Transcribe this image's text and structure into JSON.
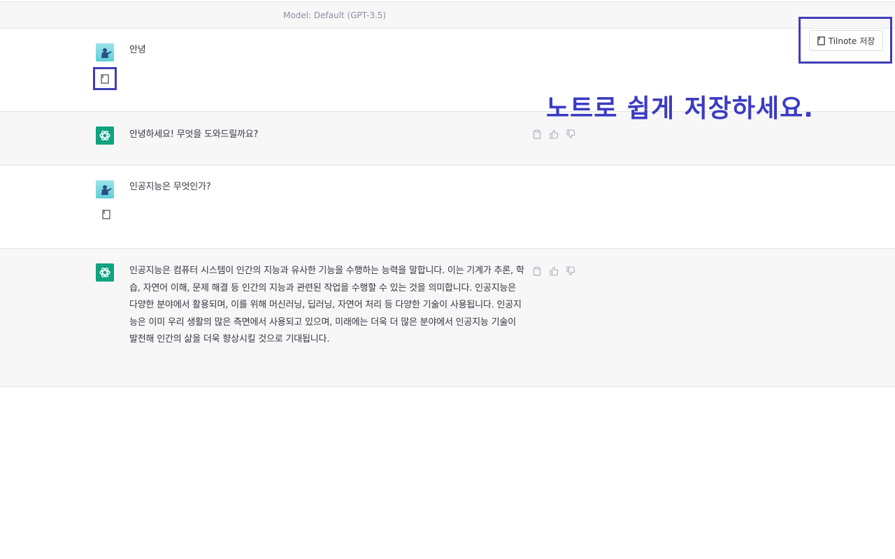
{
  "header": {
    "model_label": "Model: Default (GPT-3.5)"
  },
  "toolbar": {
    "save_button_label": "Tilnote 저장"
  },
  "promo": {
    "text": "노트로 쉽게 저장하세요."
  },
  "messages": [
    {
      "role": "user",
      "text": "안녕"
    },
    {
      "role": "assistant",
      "text": "안녕하세요! 무엇을 도와드릴까요?"
    },
    {
      "role": "user",
      "text": "인공지능은 무엇인가?"
    },
    {
      "role": "assistant",
      "text": "인공지능은 컴퓨터 시스템이 인간의 지능과 유사한 기능을 수행하는 능력을 말합니다. 이는 기계가 추론, 학습, 자연어 이해, 문제 해결 등 인간의 지능과 관련된 작업을 수행할 수 있는 것을 의미합니다. 인공지능은 다양한 분야에서 활용되며, 이를 위해 머신러닝, 딥러닝, 자연어 처리 등 다양한 기술이 사용됩니다. 인공지능은 이미 우리 생활의 많은 측면에서 사용되고 있으며, 미래에는 더욱 더 많은 분야에서 인공지능 기술이 발전해 인간의 삶을 더욱 향상시킬 것으로 기대됩니다."
    }
  ],
  "icons": {
    "note": "note-icon",
    "copy": "clipboard-icon",
    "thumbs_up": "thumbs-up-icon",
    "thumbs_down": "thumbs-down-icon",
    "openai": "openai-logo-icon"
  },
  "colors": {
    "highlight": "#3f3fb8",
    "promo_text": "#3b3bc4",
    "assistant_bg": "#f7f7f8",
    "gpt_avatar": "#10a37f"
  }
}
